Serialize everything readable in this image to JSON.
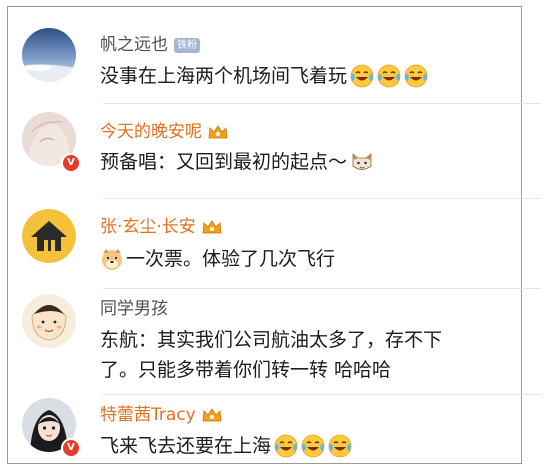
{
  "comments": [
    {
      "username": "帆之远也",
      "badge": "铁粉",
      "text": "没事在上海两个机场间飞着玩",
      "emojis": [
        "laugh-cry-emoji",
        "laugh-cry-emoji",
        "laugh-cry-emoji"
      ]
    },
    {
      "username": "今天的晚安呢",
      "text": "预备唱：又回到最初的起点～",
      "emojis": [
        "cat-face-emoji"
      ]
    },
    {
      "username": "张·玄尘·长安",
      "leading_emoji": "doge-emoji",
      "text": "一次票。体验了几次飞行"
    },
    {
      "username": "同学男孩",
      "text_lines": [
        "东航：其实我们公司航油太多了，存不下",
        "了。只能多带着你们转一转 哈哈哈"
      ]
    },
    {
      "username": "特蕾茜Tracy",
      "text": "飞来飞去还要在上海",
      "emojis": [
        "laugh-cry-emoji",
        "laugh-cry-emoji",
        "laugh-cry-emoji"
      ]
    }
  ],
  "colors": {
    "vip_name": "#e3701f",
    "normal_name": "#4f4f4f",
    "text": "#1c1c1c",
    "verified_badge": "#e8392b",
    "fan_badge": "#a5b4cf"
  }
}
